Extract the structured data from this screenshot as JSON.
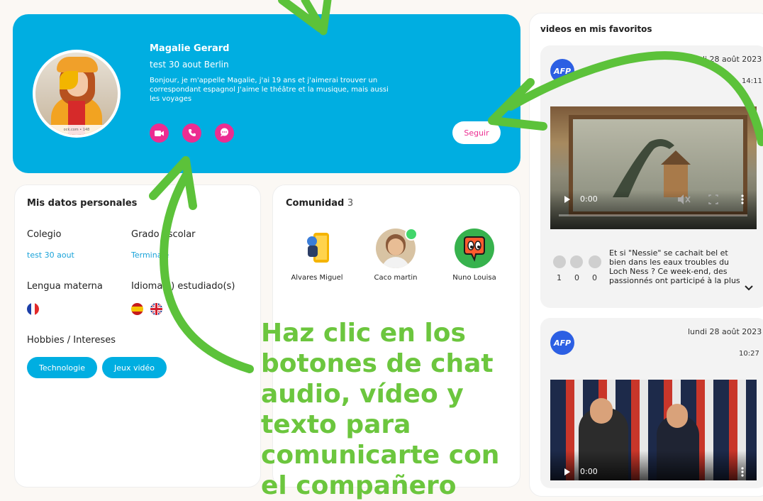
{
  "profile": {
    "name": "Magalie Gerard",
    "location": "test 30 aout Berlin",
    "bio": "Bonjour, je m'appelle Magalie, j'ai 19 ans et j'aimerai trouver un correspondant espagnol J'aime le théâtre et la musique, mais aussi les voyages",
    "follow_label": "Seguir",
    "avatar_caption": "ock.com • 148",
    "contact_buttons": [
      "video-call",
      "audio-call",
      "text-chat"
    ]
  },
  "datos": {
    "title": "Mis datos personales",
    "colegio_label": "Colegio",
    "colegio_value": "test 30 aout",
    "grado_label": "Grado escolar",
    "grado_value": "Terminale",
    "lengua_label": "Lengua materna",
    "idiomas_label": "Idioma(s) estudiado(s)",
    "hobbies_label": "Hobbies / Intereses",
    "hobbies": [
      "Technologie",
      "Jeux vidéo"
    ]
  },
  "comunidad": {
    "title": "Comunidad",
    "count": "3",
    "members": [
      "Alvares Miguel",
      "Caco martin",
      "Nuno Louisa"
    ]
  },
  "videos": {
    "title": "videos en mis favoritos",
    "items": [
      {
        "source": "AFP",
        "date": "lundi 28 août 2023",
        "time": "14:11",
        "player_time": "0:00",
        "reactions": [
          "1",
          "0",
          "0"
        ],
        "description": "Et si \"Nessie\" se cachait bel et bien dans les eaux troubles du Loch Ness ? Ce week-end, des passionnés ont participé à la plus"
      },
      {
        "source": "AFP",
        "date": "lundi 28 août 2023",
        "time": "10:27",
        "player_time": "0:00"
      }
    ]
  },
  "overlay": {
    "text": "Haz clic en los botones de  chat audio, vídeo y texto para comunicarte con el compañero"
  },
  "colors": {
    "accent_blue": "#00aee1",
    "accent_pink": "#ec2d91",
    "overlay_green": "#6cc63e"
  }
}
